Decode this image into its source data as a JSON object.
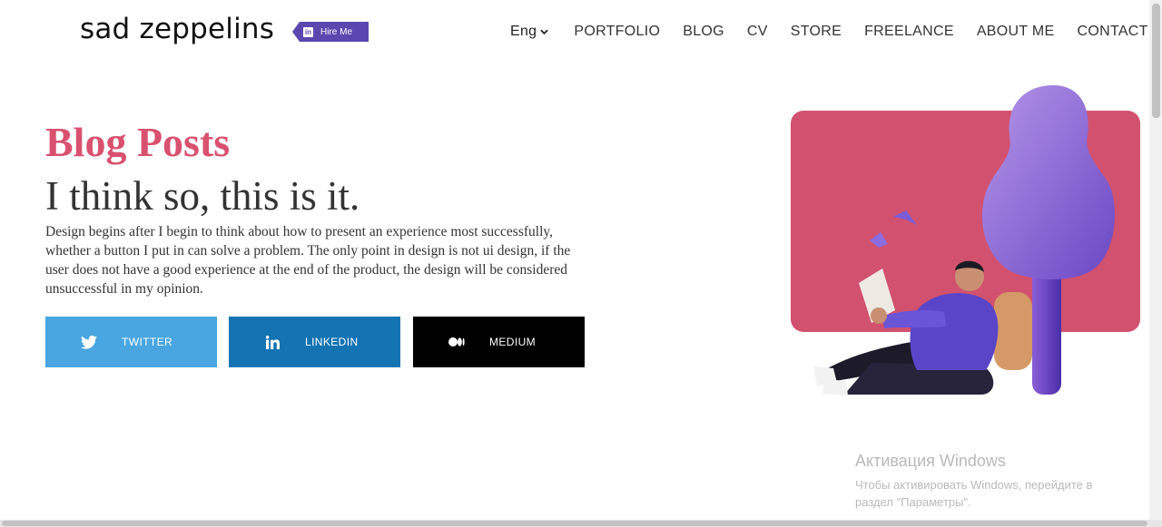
{
  "header": {
    "logo": "sad zeppelins",
    "hire_label": "Hire Me",
    "language": "Eng",
    "nav": [
      "PORTFOLIO",
      "BLOG",
      "CV",
      "STORE",
      "FREELANCE",
      "ABOUT ME",
      "CONTACT"
    ]
  },
  "hero": {
    "eyebrow": "Blog Posts",
    "headline": "I think so, this is it.",
    "body": "Design begins after I begin to think about how to present an experience most successfully, whether a button I put in can solve a problem. The only point in design is not ui design, if the user does not have a good experience at the end of the product, the design will be considered unsuccessful in my opinion."
  },
  "social": {
    "twitter": "TWITTER",
    "linkedin": "LINKEDIN",
    "medium": "MEDIUM"
  },
  "watermark": {
    "title": "Активация Windows",
    "text": "Чтобы активировать Windows, перейдите в раздел \"Параметры\"."
  },
  "colors": {
    "accent": "#d9516f",
    "hire": "#5a47b0",
    "twitter": "#49a6e0",
    "linkedin": "#1373b3",
    "medium": "#000000"
  }
}
